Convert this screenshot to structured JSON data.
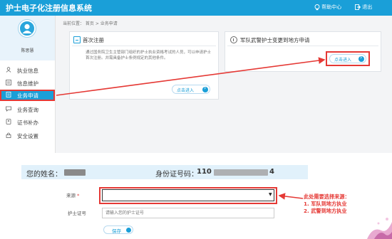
{
  "app": {
    "title": "护士电子化注册信息系统"
  },
  "header": {
    "help_label": "帮助中心",
    "logout_label": "退出"
  },
  "user": {
    "name": "陈思慧"
  },
  "sidebar": {
    "items": [
      {
        "label": "执业信息",
        "icon": "person-icon"
      },
      {
        "label": "信息维护",
        "icon": "list-icon"
      },
      {
        "label": "业务申请",
        "icon": "document-icon"
      },
      {
        "label": "业务查询",
        "icon": "chat-icon"
      },
      {
        "label": "证书补办",
        "icon": "card-icon"
      },
      {
        "label": "安全设置",
        "icon": "lock-icon"
      }
    ],
    "active_index": 2
  },
  "breadcrumb": "当前位置： 首页 > 业务申请",
  "cards": [
    {
      "title": "首次注册",
      "description": "通过国务院卫生主管部门组织的护士执业资格考试的人员，可以申请护士首次注册。并需具备护士条例规定的其他条件。",
      "button": "点击进入"
    },
    {
      "title": "军队武警护士变更到地方申请",
      "button": "点击进入"
    }
  ],
  "form": {
    "name_label": "您的姓名：",
    "id_label": "身份证号码：",
    "id_prefix": "110",
    "id_suffix": "4",
    "source_label": "来源",
    "required_mark": "*",
    "source_value": "",
    "nurse_cert_label": "护士证号",
    "nurse_cert_placeholder": "请输入您的护士证号",
    "save_label": "保存"
  },
  "annotation": {
    "lines": [
      "此处需要选择来源：",
      "1. 军队到地方执业",
      "2. 武警到地方执业"
    ]
  },
  "colors": {
    "primary": "#1a9fd8",
    "highlight": "#e53935",
    "panel": "#e1f1fb"
  }
}
